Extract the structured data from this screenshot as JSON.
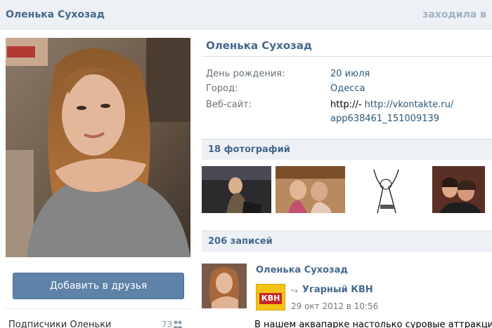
{
  "header": {
    "name": "Оленька Сухозад",
    "status": "заходила в"
  },
  "profile": {
    "name": "Оленька Сухозад",
    "info": [
      {
        "label": "День рождения:",
        "value": "20 июля"
      },
      {
        "label": "Город:",
        "value": "Одесса"
      },
      {
        "label": "Веб-сайт:",
        "value_prefix": "http://-",
        "value_link": "http://vkontakte.ru/",
        "value_link_cont": "app638461_151009139"
      }
    ]
  },
  "sidebar": {
    "add_friend_label": "Добавить в друзья",
    "subscribers_label": "Подписчики Оленьки",
    "subscribers_count": "73"
  },
  "photos": {
    "header": "18 фотографий",
    "items": [
      "photo-1",
      "photo-2",
      "photo-3",
      "photo-4"
    ]
  },
  "wall": {
    "header": "206 записей",
    "post": {
      "author": "Оленька Сухозад",
      "repost_source": "Угарный КВН",
      "repost_logo_text": "КВН",
      "date": "29 окт 2012 в 10:56",
      "text": "В нашем аквапарке настолько суровые аттракци"
    }
  },
  "colors": {
    "accent": "#45688e",
    "button": "#5e82a8",
    "header_bg": "#edf1f5"
  }
}
